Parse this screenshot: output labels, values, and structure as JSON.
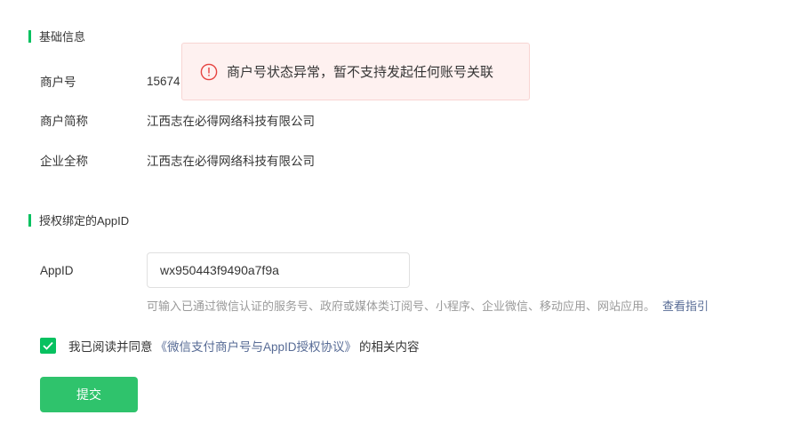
{
  "basic_info": {
    "title": "基础信息",
    "merchant_no_label": "商户号",
    "merchant_no_value": "15674",
    "short_name_label": "商户简称",
    "short_name_value": "江西志在必得网络科技有限公司",
    "full_name_label": "企业全称",
    "full_name_value": "江西志在必得网络科技有限公司"
  },
  "appid_section": {
    "title": "授权绑定的AppID",
    "appid_label": "AppID",
    "appid_value": "wx950443f9490a7f9a",
    "hint": "可输入已通过微信认证的服务号、政府或媒体类订阅号、小程序、企业微信、移动应用、网站应用。",
    "guide_link": "查看指引"
  },
  "agreement": {
    "checked": true,
    "prefix": "我已阅读并同意",
    "link": "《微信支付商户号与AppID授权协议》",
    "suffix": "的相关内容"
  },
  "submit_label": "提交",
  "toast": {
    "icon": "warning-circle-icon",
    "message": "商户号状态异常，暂不支持发起任何账号关联"
  },
  "colors": {
    "accent": "#07c160",
    "button": "#2fc36c",
    "link": "#576b95",
    "toast_bg": "#fef1f0",
    "error": "#e64340"
  }
}
